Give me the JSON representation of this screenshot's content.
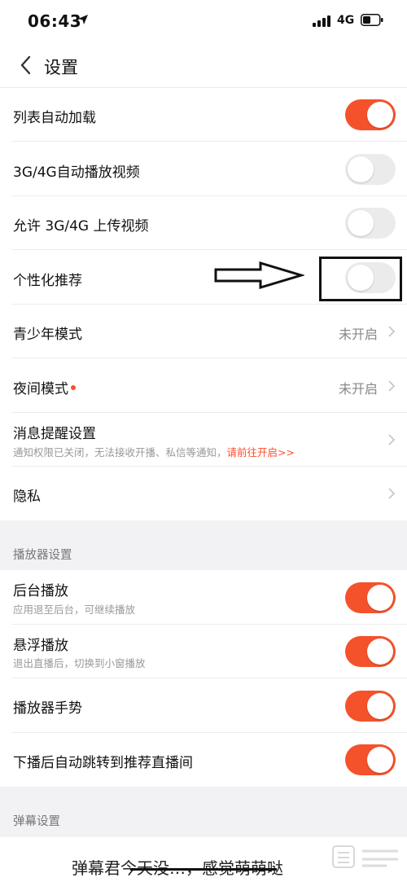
{
  "status": {
    "time": "06:43",
    "network": "4G"
  },
  "header": {
    "title": "设置"
  },
  "rows": [
    {
      "label": "列表自动加载",
      "state": "on"
    },
    {
      "label": "3G/4G自动播放视频",
      "state": "off"
    },
    {
      "label": "允许 3G/4G 上传视频",
      "state": "off"
    },
    {
      "label": "个性化推荐",
      "state": "off"
    },
    {
      "label": "青少年模式",
      "value": "未开启"
    },
    {
      "label": "夜间模式",
      "value": "未开启"
    },
    {
      "label": "消息提醒设置",
      "sub": "通知权限已关闭，无法接收开播、私信等通知，",
      "sub_link": "请前往开启>>"
    },
    {
      "label": "隐私"
    }
  ],
  "player_section": {
    "title": "播放器设置",
    "rows": [
      {
        "label": "后台播放",
        "sub": "应用退至后台，可继续播放",
        "state": "on"
      },
      {
        "label": "悬浮播放",
        "sub": "退出直播后，切换到小窗播放",
        "state": "on"
      },
      {
        "label": "播放器手势",
        "state": "on"
      },
      {
        "label": "下播后自动跳转到推荐直播间",
        "state": "on"
      }
    ]
  },
  "danmaku_section": {
    "title": "弹幕设置"
  },
  "bottom_text": "弹幕君今天没…，感觉萌萌哒",
  "colors": {
    "accent": "#f5522c",
    "toggle_off": "#ebebeb"
  }
}
